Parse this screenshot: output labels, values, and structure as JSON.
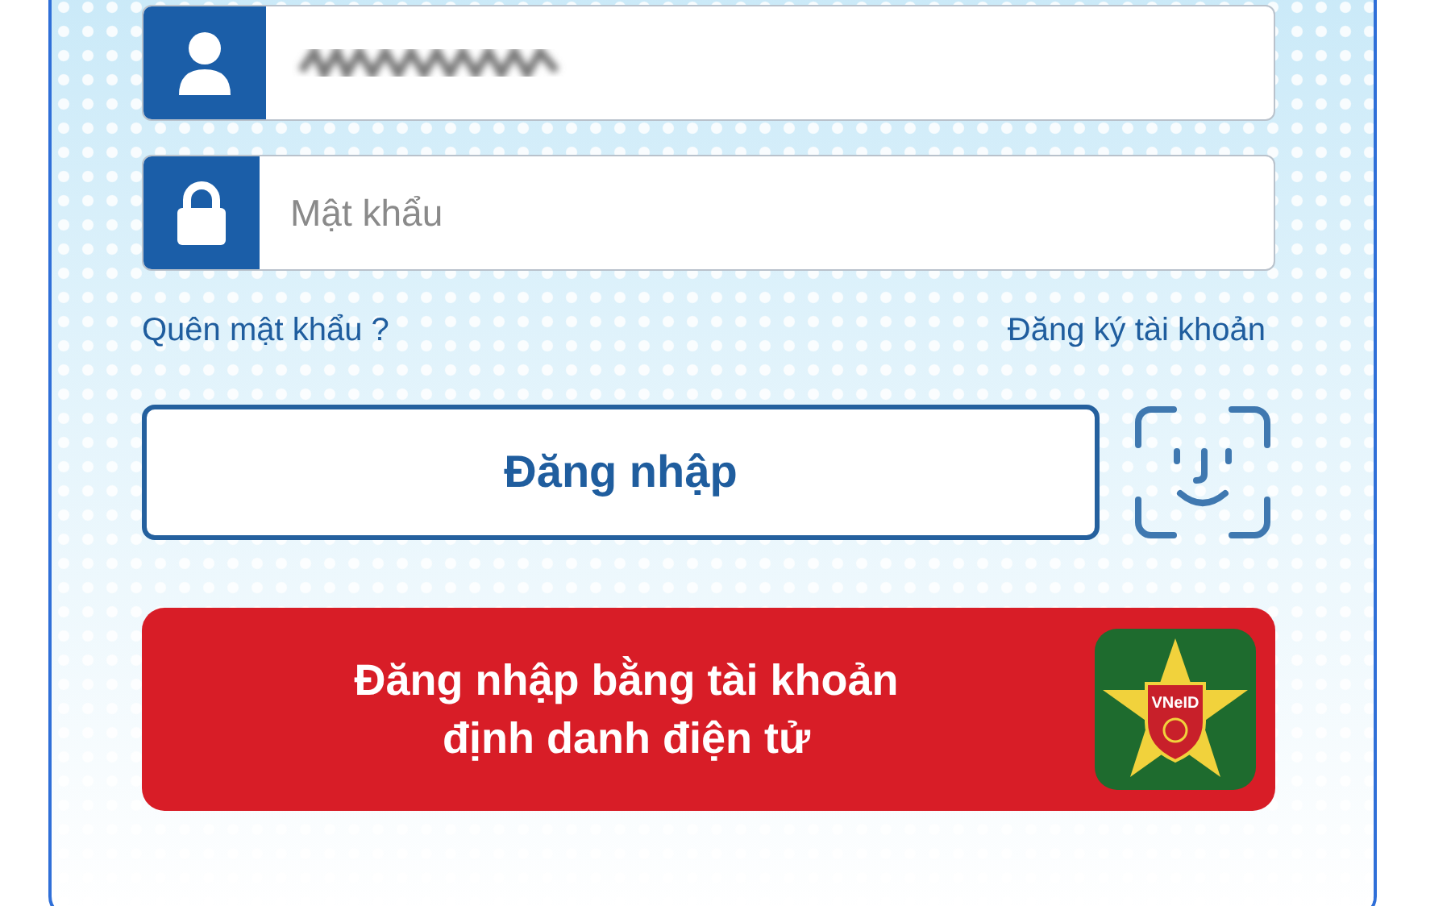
{
  "login_form": {
    "username_field": {
      "blurred": true
    },
    "password_field": {
      "placeholder": "Mật khẩu"
    },
    "forgot_password_link": "Quên mật khẩu ?",
    "register_link": "Đăng ký tài khoản",
    "login_button": "Đăng nhập",
    "vneid_button": {
      "label_lines": [
        "Đăng nhập bằng tài khoản",
        "định danh điện tử"
      ],
      "logo_text": "VNeID"
    }
  }
}
